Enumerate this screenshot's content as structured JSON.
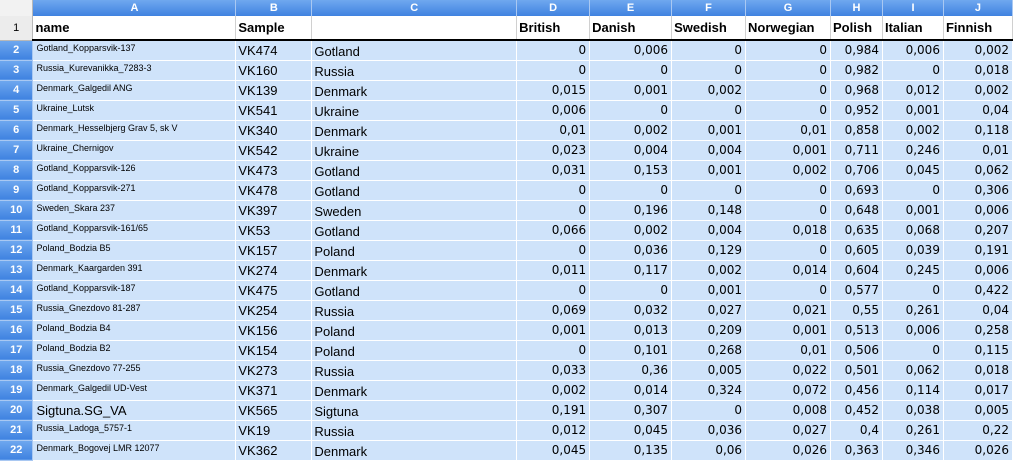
{
  "columns": [
    "A",
    "B",
    "C",
    "D",
    "E",
    "F",
    "G",
    "H",
    "I",
    "J"
  ],
  "header_row_number": "1",
  "headers": [
    "name",
    "Sample",
    "",
    "British",
    "Danish",
    "Swedish",
    "Norwegian",
    "Polish",
    "Italian",
    "Finnish"
  ],
  "rows": [
    {
      "n": "2",
      "name": "Gotland_Kopparsvik-137",
      "sample": "VK474",
      "country": "Gotland",
      "vals": [
        "0",
        "0,006",
        "0",
        "0",
        "0,984",
        "0,006",
        "0,002"
      ]
    },
    {
      "n": "3",
      "name": "Russia_Kurevanikka_7283-3",
      "sample": "VK160",
      "country": "Russia",
      "vals": [
        "0",
        "0",
        "0",
        "0",
        "0,982",
        "0",
        "0,018"
      ]
    },
    {
      "n": "4",
      "name": "Denmark_Galgedil ANG",
      "sample": "VK139",
      "country": "Denmark",
      "vals": [
        "0,015",
        "0,001",
        "0,002",
        "0",
        "0,968",
        "0,012",
        "0,002"
      ]
    },
    {
      "n": "5",
      "name": "Ukraine_Lutsk",
      "sample": "VK541",
      "country": "Ukraine",
      "vals": [
        "0,006",
        "0",
        "0",
        "0",
        "0,952",
        "0,001",
        "0,04"
      ]
    },
    {
      "n": "6",
      "name": "Denmark_Hesselbjerg Grav 5, sk V",
      "sample": "VK340",
      "country": "Denmark",
      "vals": [
        "0,01",
        "0,002",
        "0,001",
        "0,01",
        "0,858",
        "0,002",
        "0,118"
      ]
    },
    {
      "n": "7",
      "name": "Ukraine_Chernigov",
      "sample": "VK542",
      "country": "Ukraine",
      "vals": [
        "0,023",
        "0,004",
        "0,004",
        "0,001",
        "0,711",
        "0,246",
        "0,01"
      ]
    },
    {
      "n": "8",
      "name": "Gotland_Kopparsvik-126",
      "sample": "VK473",
      "country": "Gotland",
      "vals": [
        "0,031",
        "0,153",
        "0,001",
        "0,002",
        "0,706",
        "0,045",
        "0,062"
      ]
    },
    {
      "n": "9",
      "name": "Gotland_Kopparsvik-271",
      "sample": "VK478",
      "country": "Gotland",
      "vals": [
        "0",
        "0",
        "0",
        "0",
        "0,693",
        "0",
        "0,306"
      ]
    },
    {
      "n": "10",
      "name": "Sweden_Skara 237",
      "sample": "VK397",
      "country": "Sweden",
      "vals": [
        "0",
        "0,196",
        "0,148",
        "0",
        "0,648",
        "0,001",
        "0,006"
      ]
    },
    {
      "n": "11",
      "name": "Gotland_Kopparsvik-161/65",
      "sample": "VK53",
      "country": "Gotland",
      "vals": [
        "0,066",
        "0,002",
        "0,004",
        "0,018",
        "0,635",
        "0,068",
        "0,207"
      ]
    },
    {
      "n": "12",
      "name": "Poland_Bodzia B5",
      "sample": "VK157",
      "country": "Poland",
      "vals": [
        "0",
        "0,036",
        "0,129",
        "0",
        "0,605",
        "0,039",
        "0,191"
      ]
    },
    {
      "n": "13",
      "name": "Denmark_Kaargarden 391",
      "sample": "VK274",
      "country": "Denmark",
      "vals": [
        "0,011",
        "0,117",
        "0,002",
        "0,014",
        "0,604",
        "0,245",
        "0,006"
      ]
    },
    {
      "n": "14",
      "name": "Gotland_Kopparsvik-187",
      "sample": "VK475",
      "country": "Gotland",
      "vals": [
        "0",
        "0",
        "0,001",
        "0",
        "0,577",
        "0",
        "0,422"
      ]
    },
    {
      "n": "15",
      "name": "Russia_Gnezdovo 81-287",
      "sample": "VK254",
      "country": "Russia",
      "vals": [
        "0,069",
        "0,032",
        "0,027",
        "0,021",
        "0,55",
        "0,261",
        "0,04"
      ]
    },
    {
      "n": "16",
      "name": "Poland_Bodzia B4",
      "sample": "VK156",
      "country": "Poland",
      "vals": [
        "0,001",
        "0,013",
        "0,209",
        "0,001",
        "0,513",
        "0,006",
        "0,258"
      ]
    },
    {
      "n": "17",
      "name": "Poland_Bodzia B2",
      "sample": "VK154",
      "country": "Poland",
      "vals": [
        "0",
        "0,101",
        "0,268",
        "0,01",
        "0,506",
        "0",
        "0,115"
      ]
    },
    {
      "n": "18",
      "name": "Russia_Gnezdovo 77-255",
      "sample": "VK273",
      "country": "Russia",
      "vals": [
        "0,033",
        "0,36",
        "0,005",
        "0,022",
        "0,501",
        "0,062",
        "0,018"
      ]
    },
    {
      "n": "19",
      "name": "Denmark_Galgedil UD-Vest",
      "sample": "VK371",
      "country": "Denmark",
      "vals": [
        "0,002",
        "0,014",
        "0,324",
        "0,072",
        "0,456",
        "0,114",
        "0,017"
      ]
    },
    {
      "n": "20",
      "name": "Sigtuna.SG_VA",
      "sample": "VK565",
      "country": "Sigtuna",
      "vals": [
        "0,191",
        "0,307",
        "0",
        "0,008",
        "0,452",
        "0,038",
        "0,005"
      ],
      "big": true
    },
    {
      "n": "21",
      "name": "Russia_Ladoga_5757-1",
      "sample": "VK19",
      "country": "Russia",
      "vals": [
        "0,012",
        "0,045",
        "0,036",
        "0,027",
        "0,4",
        "0,261",
        "0,22"
      ]
    },
    {
      "n": "22",
      "name": "Denmark_Bogovej LMR 12077",
      "sample": "VK362",
      "country": "Denmark",
      "vals": [
        "0,045",
        "0,135",
        "0,06",
        "0,026",
        "0,363",
        "0,346",
        "0,026"
      ]
    }
  ]
}
